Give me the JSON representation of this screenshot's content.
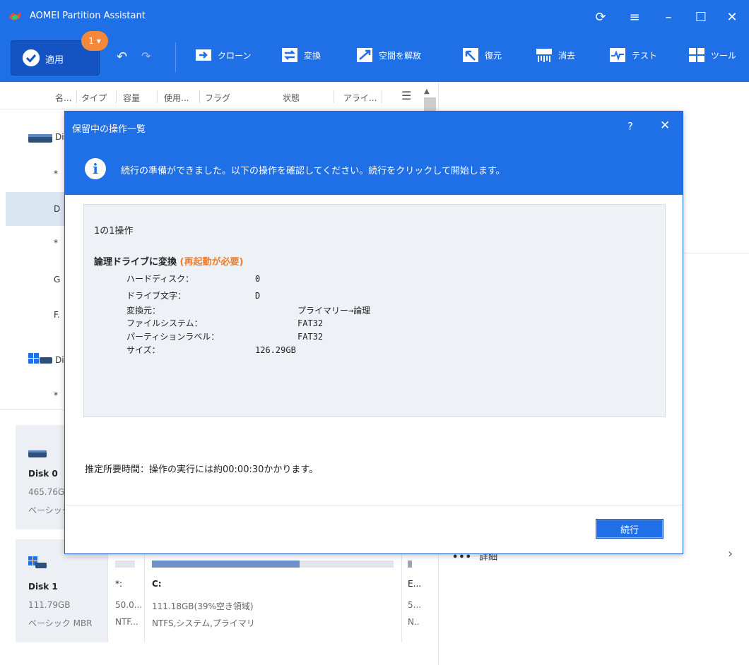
{
  "window": {
    "title": "AOMEI Partition Assistant"
  },
  "toolbar": {
    "apply_label": "適用",
    "pending_badge": "1",
    "items": [
      "クローン",
      "変換",
      "空間を解放",
      "復元",
      "消去",
      "テスト",
      "ツール"
    ]
  },
  "columns": [
    "名...",
    "タイプ",
    "容量",
    "使用...",
    "フラグ",
    "状態",
    "アライ..."
  ],
  "list_rows": [
    {
      "label": "Di"
    },
    {
      "label": "*"
    },
    {
      "label": "D"
    },
    {
      "label": "*"
    },
    {
      "label": "G"
    },
    {
      "label": "F."
    },
    {
      "label": "Di"
    },
    {
      "label": "*"
    }
  ],
  "disk0": {
    "name": "Disk 0",
    "size": "465.76G",
    "type": "ベーシック"
  },
  "disk1": {
    "name": "Disk 1",
    "size": "111.79GB",
    "type": "ベーシック MBR",
    "partitions": [
      {
        "letter": "*:",
        "size": "50.0...",
        "fs": "NTF..."
      },
      {
        "letter": "C:",
        "size": "111.18GB(39%空き領域)",
        "fs": "NTFS,システム,プライマリ",
        "used_fraction": 0.61
      },
      {
        "letter": "E...",
        "size": "5...",
        "fs": "N.."
      }
    ]
  },
  "right_panel": {
    "detail_label": "詳細"
  },
  "dialog": {
    "title": "保留中の操作一覧",
    "help": "?",
    "close": "✕",
    "info": "続行の準備ができました。以下の操作を確認してください。続行をクリックして開始します。",
    "op_count": "1の1操作",
    "op_title": "論理ドライブに変換",
    "op_note": "(再起動が必要)",
    "details": [
      {
        "label": "ハードディスク：",
        "value": "0"
      },
      {
        "label": "ドライブ文字：",
        "value": "D"
      },
      {
        "label": "変換元：",
        "value": "プライマリー→論理"
      },
      {
        "label": "ファイルシステム：",
        "value": "FAT32"
      },
      {
        "label": "パーティションラベル：",
        "value": "FAT32"
      },
      {
        "label": "サイズ：",
        "value": "126.29GB"
      }
    ],
    "estimate": "推定所要時間：操作の実行には約00:00:30かかります。",
    "continue_label": "続行"
  }
}
